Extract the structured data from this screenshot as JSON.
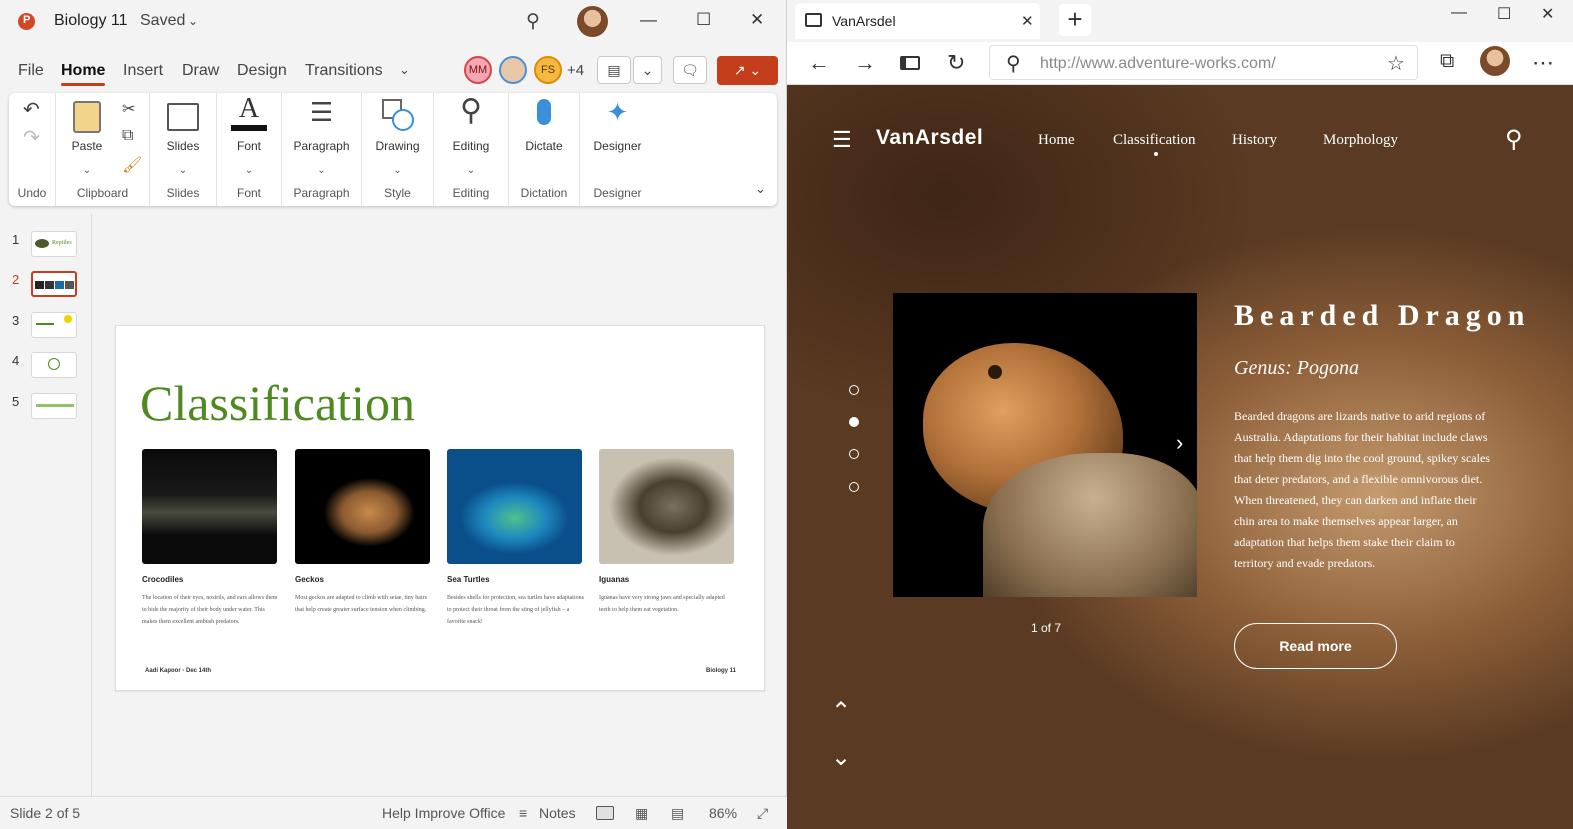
{
  "ppt": {
    "doc_name": "Biology 11",
    "save_state": "Saved",
    "tabs": [
      "File",
      "Home",
      "Insert",
      "Draw",
      "Design",
      "Transitions"
    ],
    "collaborators": [
      {
        "initials": "MM",
        "color": "#f4a7b3"
      },
      {
        "initials": "",
        "color": "#4a90d9"
      },
      {
        "initials": "FS",
        "color": "#f5b942"
      }
    ],
    "more_collaborators": "+4",
    "ribbon": {
      "undo_label": "Undo",
      "clipboard": {
        "paste": "Paste",
        "group": "Clipboard"
      },
      "slides": {
        "button": "Slides",
        "group": "Slides"
      },
      "font": {
        "button": "Font",
        "group": "Font"
      },
      "paragraph": {
        "button": "Paragraph",
        "group": "Paragraph"
      },
      "drawing": {
        "button": "Drawing",
        "group": "Style"
      },
      "editing": {
        "button": "Editing",
        "group": "Editing"
      },
      "dictate": {
        "button": "Dictate",
        "group": "Dictation"
      },
      "designer": {
        "button": "Designer",
        "group": "Designer"
      }
    },
    "thumbnails": [
      {
        "num": "1",
        "caption": "Reptiles"
      },
      {
        "num": "2",
        "caption": ""
      },
      {
        "num": "3",
        "caption": ""
      },
      {
        "num": "4",
        "caption": ""
      },
      {
        "num": "5",
        "caption": ""
      }
    ],
    "slide": {
      "title": "Classification",
      "cards": [
        {
          "heading": "Crocodiles",
          "body": "The location of their eyes, nostrils, and ears allows them to hide the majority of their body under water. This makes them excellent ambush predators."
        },
        {
          "heading": "Geckos",
          "body": "Most geckos are adapted to climb with setae, tiny hairs that help create greater surface tension when climbing."
        },
        {
          "heading": "Sea Turtles",
          "body": "Besides shells for protection, sea turtles have adaptations to protect their throat from the sting of jellyfish – a favorite snack!"
        },
        {
          "heading": "Iguanas",
          "body": "Iguanas have very strong jaws and specially adapted teeth to help them eat vegetation."
        }
      ],
      "footer_left": "Aadi Kapoor - Dec 14th",
      "footer_right": "Biology 11"
    },
    "status": {
      "slide_count": "Slide 2 of 5",
      "help": "Help Improve Office",
      "notes": "Notes",
      "zoom": "86%"
    },
    "accent": "#c43e1c"
  },
  "edge": {
    "tab_title": "VanArsdel",
    "url": "http://www.adventure-works.com/",
    "site": {
      "logo": "VanArsdel",
      "nav": [
        "Home",
        "Classification",
        "History",
        "Morphology"
      ],
      "active_nav": "Classification",
      "title": "Bearded Dragon",
      "genus": "Genus: Pogona",
      "description": "Bearded dragons are lizards native to arid regions of Australia. Adaptations for their habitat include claws that help them dig into the cool ground, spikey scales that deter predators, and a flexible omnivorous diet. When threatened, they can darken and inflate their chin area to make themselves appear larger, an adaptation that helps them stake their claim to territory and evade predators.",
      "counter": "1 of 7",
      "read_more": "Read more"
    }
  }
}
